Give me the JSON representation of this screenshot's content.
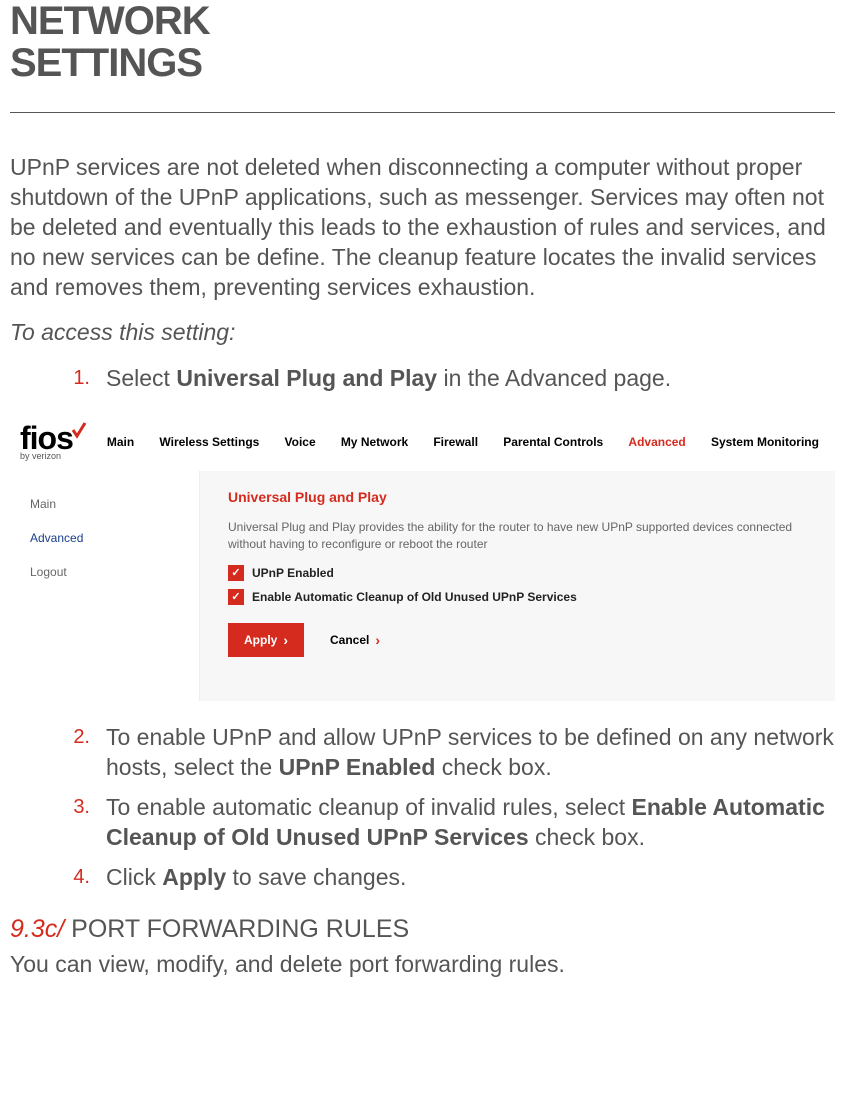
{
  "title_line1": "NETWORK",
  "title_line2": "SETTINGS",
  "intro": "UPnP services are not deleted when disconnecting a computer without proper shutdown of the UPnP applications, such as messenger. Services may often not be deleted and eventually this leads to the exhaustion of rules and services, and no new services can be define. The cleanup feature locates the invalid services and removes them, preventing services exhaustion.",
  "access_label": "To access this setting:",
  "steps": {
    "s1_num": "1.",
    "s1_pre": "Select ",
    "s1_bold": "Universal Plug and Play",
    "s1_post": " in the Advanced page.",
    "s2_num": "2.",
    "s2_pre": "To enable UPnP and allow UPnP services to be defined on any network hosts, select the ",
    "s2_bold": "UPnP Enabled",
    "s2_post": " check box.",
    "s3_num": "3.",
    "s3_pre": "To enable automatic cleanup of invalid rules, select ",
    "s3_bold": "Enable Automatic Cleanup of Old Unused UPnP Services",
    "s3_post": " check box.",
    "s4_num": "4.",
    "s4_pre": "Click ",
    "s4_bold": "Apply",
    "s4_post": " to save changes."
  },
  "router": {
    "logo_main": "fios",
    "logo_sub": "by verizon",
    "nav": {
      "main": "Main",
      "wireless": "Wireless Settings",
      "voice": "Voice",
      "network": "My Network",
      "firewall": "Firewall",
      "parental": "Parental Controls",
      "advanced": "Advanced",
      "sysmon": "System Monitoring"
    },
    "sidebar": {
      "main": "Main",
      "advanced": "Advanced",
      "logout": "Logout"
    },
    "panel": {
      "title": "Universal Plug and Play",
      "desc": "Universal Plug and Play provides the ability for the router to have new UPnP supported devices connected without having to reconfigure or reboot the router",
      "cb1": "UPnP Enabled",
      "cb2": "Enable Automatic Cleanup of Old Unused UPnP Services",
      "apply": "Apply",
      "cancel": "Cancel"
    }
  },
  "section": {
    "num": "9.3c/ ",
    "title": "PORT FORWARDING RULES",
    "desc": "You can view, modify, and delete port forwarding rules."
  }
}
